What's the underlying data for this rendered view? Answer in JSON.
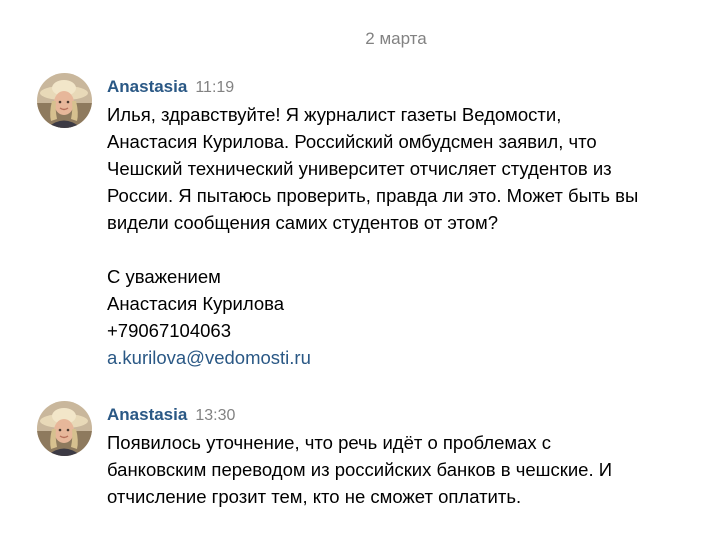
{
  "date_divider": "2 марта",
  "messages": [
    {
      "author": "Anastasia",
      "time": "11:19",
      "lines": [
        "Илья, здравствуйте! Я журналист газеты Ведомости,",
        "Анастасия Курилова. Российский омбудсмен заявил, что",
        "Чешский технический университет отчисляет студентов из",
        "России. Я пытаюсь проверить, правда ли это. Может быть вы",
        "видели сообщения самих студентов от этом?"
      ],
      "signature": [
        "С уважением",
        "Анастасия Курилова",
        "+79067104063"
      ],
      "email": "a.kurilova@vedomosti.ru"
    },
    {
      "author": "Anastasia",
      "time": "13:30",
      "lines": [
        "Появилось уточнение, что речь идёт о проблемах с",
        "банковским переводом из российских банков в чешские. И",
        "отчисление грозит тем, кто не сможет оплатить."
      ]
    }
  ],
  "colors": {
    "author": "#2a5885",
    "link": "#2a5885",
    "meta": "#828282",
    "text": "#000000"
  }
}
